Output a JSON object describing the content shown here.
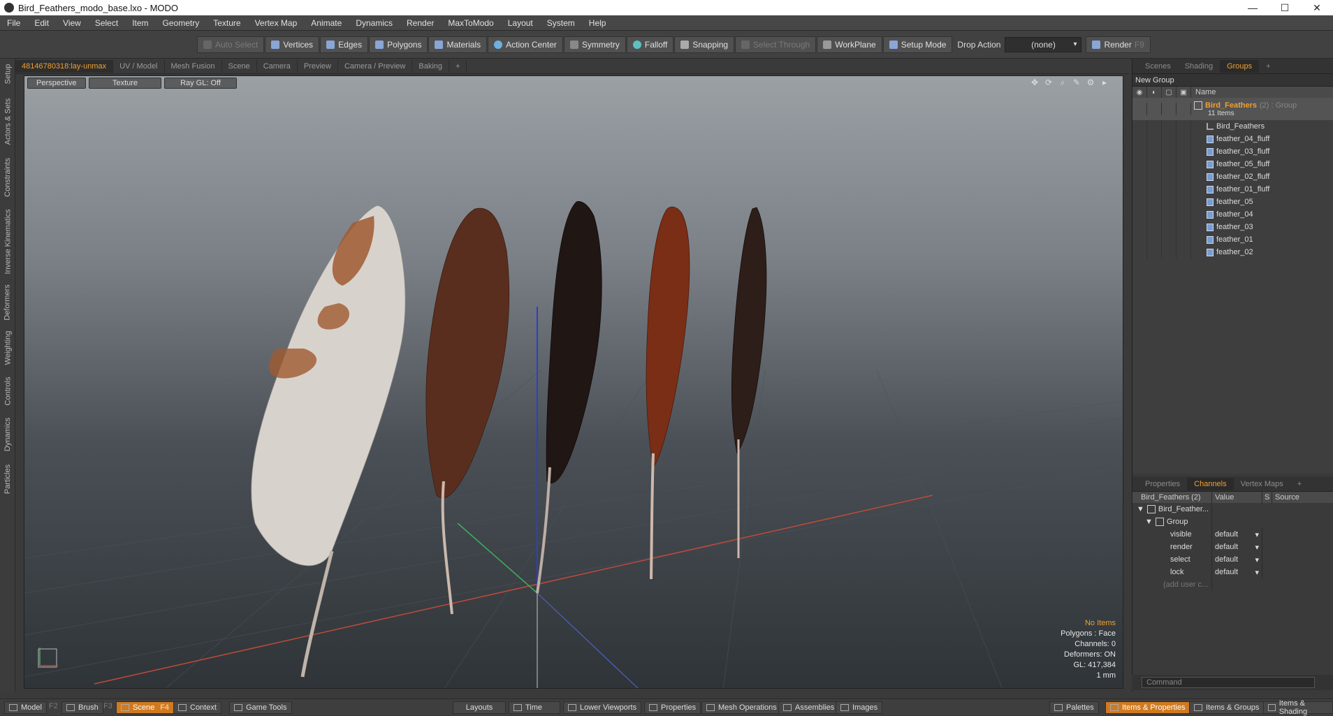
{
  "window": {
    "title": "Bird_Feathers_modo_base.lxo - MODO",
    "minimize": "—",
    "maximize": "☐",
    "close": "✕"
  },
  "menu": [
    "File",
    "Edit",
    "View",
    "Select",
    "Item",
    "Geometry",
    "Texture",
    "Vertex Map",
    "Animate",
    "Dynamics",
    "Render",
    "MaxToModo",
    "Layout",
    "System",
    "Help"
  ],
  "toolbar": {
    "auto_select": "Auto Select",
    "vertices": "Vertices",
    "edges": "Edges",
    "polygons": "Polygons",
    "materials": "Materials",
    "action_center": "Action Center",
    "symmetry": "Symmetry",
    "falloff": "Falloff",
    "snapping": "Snapping",
    "select_through": "Select Through",
    "workplane": "WorkPlane",
    "setup_mode": "Setup Mode",
    "drop_action_label": "Drop Action",
    "drop_action_value": "(none)",
    "render": "Render",
    "render_key": "F9"
  },
  "left_tabs": [
    "Setup",
    "Actors & Sets",
    "Constraints",
    "Inverse Kinematics",
    "Deformers",
    "Weighting",
    "Controls",
    "Dynamics",
    "Particles"
  ],
  "viewport_tabs": [
    "48146780318:lay-unmax",
    "UV / Model",
    "Mesh Fusion",
    "Scene",
    "Camera",
    "Preview",
    "Camera / Preview",
    "Baking",
    "+"
  ],
  "viewport": {
    "perspective": "Perspective",
    "texture": "Texture",
    "raygl": "Ray GL: Off",
    "icons": [
      "✥",
      "⟳",
      "⌕",
      "✎",
      "⚙",
      "▸"
    ],
    "hud": {
      "no_items": "No Items",
      "polygons": "Polygons : Face",
      "channels": "Channels: 0",
      "deformers": "Deformers: ON",
      "gl": "GL: 417,384",
      "scale": "1 mm"
    }
  },
  "right_panel": {
    "top_tabs": [
      "Scenes",
      "Shading",
      "Groups",
      "+"
    ],
    "new_group": "New Group",
    "name_header": "Name",
    "group": {
      "name": "Bird_Feathers",
      "suffix": "(2) : Group",
      "count": "11 Items"
    },
    "items": [
      "Bird_Feathers",
      "feather_04_fluff",
      "feather_03_fluff",
      "feather_05_fluff",
      "feather_02_fluff",
      "feather_01_fluff",
      "feather_05",
      "feather_04",
      "feather_03",
      "feather_01",
      "feather_02"
    ],
    "bottom_tabs": [
      "Properties",
      "Channels",
      "Vertex Maps",
      "+"
    ],
    "channels_header": {
      "name": "Bird_Feathers (2)",
      "value": "Value",
      "s": "S",
      "source": "Source"
    },
    "channels_root": "Bird_Feather...",
    "channels_group": "Group",
    "channels": [
      {
        "name": "visible",
        "value": "default"
      },
      {
        "name": "render",
        "value": "default"
      },
      {
        "name": "select",
        "value": "default"
      },
      {
        "name": "lock",
        "value": "default"
      }
    ],
    "add_user": "(add user c...",
    "command_placeholder": "Command"
  },
  "statusbar": {
    "model": "Model",
    "model_key": "F2",
    "brush": "Brush",
    "brush_key": "F3",
    "scene": "Scene",
    "scene_key": "F4",
    "context": "Context",
    "game_tools": "Game Tools",
    "layouts": "Layouts",
    "time": "Time",
    "lower_viewports": "Lower Viewports",
    "properties": "Properties",
    "mesh_operations": "Mesh Operations",
    "assemblies": "Assemblies",
    "images": "Images",
    "palettes": "Palettes",
    "items_properties": "Items & Properties",
    "items_groups": "Items & Groups",
    "items_shading": "Items & Shading"
  },
  "colors": {
    "accent": "#f0a030",
    "active_tab": "#d07a20"
  }
}
